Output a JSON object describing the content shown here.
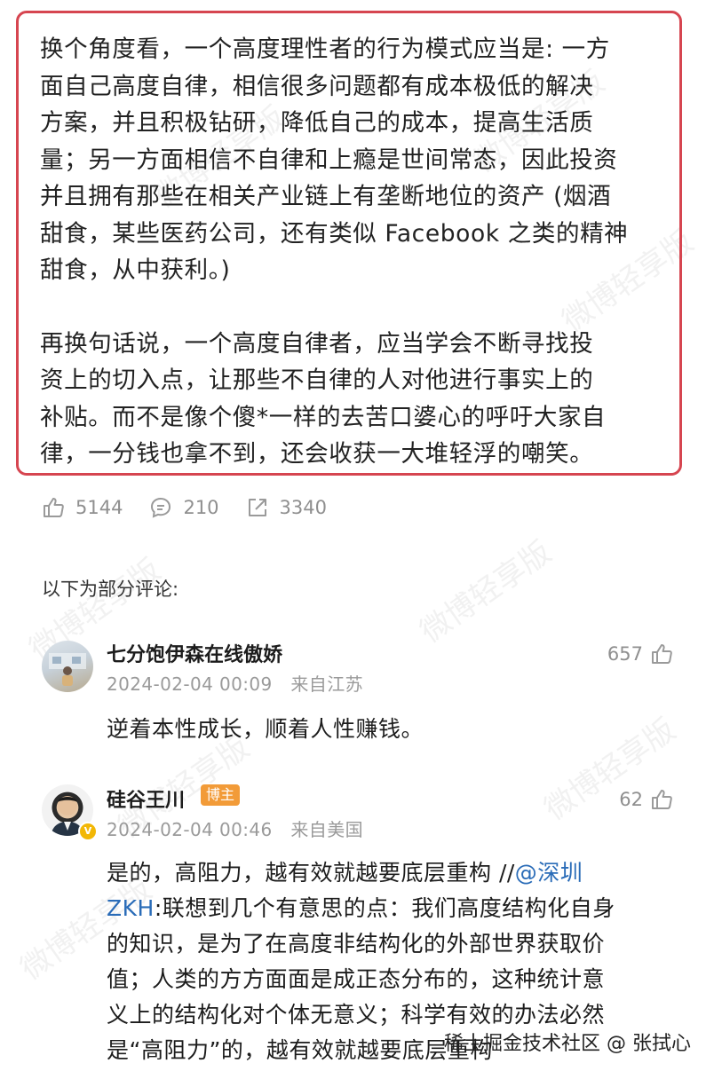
{
  "quote": {
    "paragraph1": "换个角度看，一个高度理性者的行为模式应当是: 一方\n面自己高度自律，相信很多问题都有成本极低的解决\n方案，并且积极钻研，降低自己的成本，提高生活质\n量；另一方面相信不自律和上瘾是世间常态，因此投资\n并且拥有那些在相关产业链上有垄断地位的资产 (烟酒\n甜食，某些医药公司，还有类似 Facebook 之类的精神\n甜食，从中获利。)",
    "paragraph2": "再换句话说，一个高度自律者，应当学会不断寻找投\n资上的切入点，让那些不自律的人对他进行事实上的\n补贴。而不是像个傻*一样的去苦口婆心的呼吁大家自\n律，一分钱也拿不到，还会收获一大堆轻浮的嘲笑。"
  },
  "stats": {
    "likes": "5144",
    "comments": "210",
    "reposts": "3340"
  },
  "section_label": "以下为部分评论:",
  "comments": [
    {
      "name": "七分饱伊森在线傲娇",
      "date": "2024-02-04 00:09",
      "location": "来自江苏",
      "likes": "657",
      "text": "逆着本性成长，顺着人性赚钱。"
    },
    {
      "name": "硅谷王川",
      "badge": "博主",
      "date": "2024-02-04 00:46",
      "location": "来自美国",
      "likes": "62",
      "text_before": "是的，高阻力，越有效就越要底层重构 //",
      "mention": "@深圳\nZKH",
      "text_after": ":联想到几个有意思的点：我们高度结构化自身\n的知识，是为了在高度非结构化的外部世界获取价\n值；人类的方方面面是成正态分布的，这种统计意\n义上的结构化对个体无意义；科学有效的办法必然\n是“高阻力”的，越有效就越要底层重构"
    }
  ],
  "watermark_text": "微博轻享版",
  "footer": "稀土掘金技术社区 @ 张拭心",
  "colors": {
    "border": "#d64550",
    "badge": "#f29b38",
    "mention": "#2a6cb8"
  }
}
